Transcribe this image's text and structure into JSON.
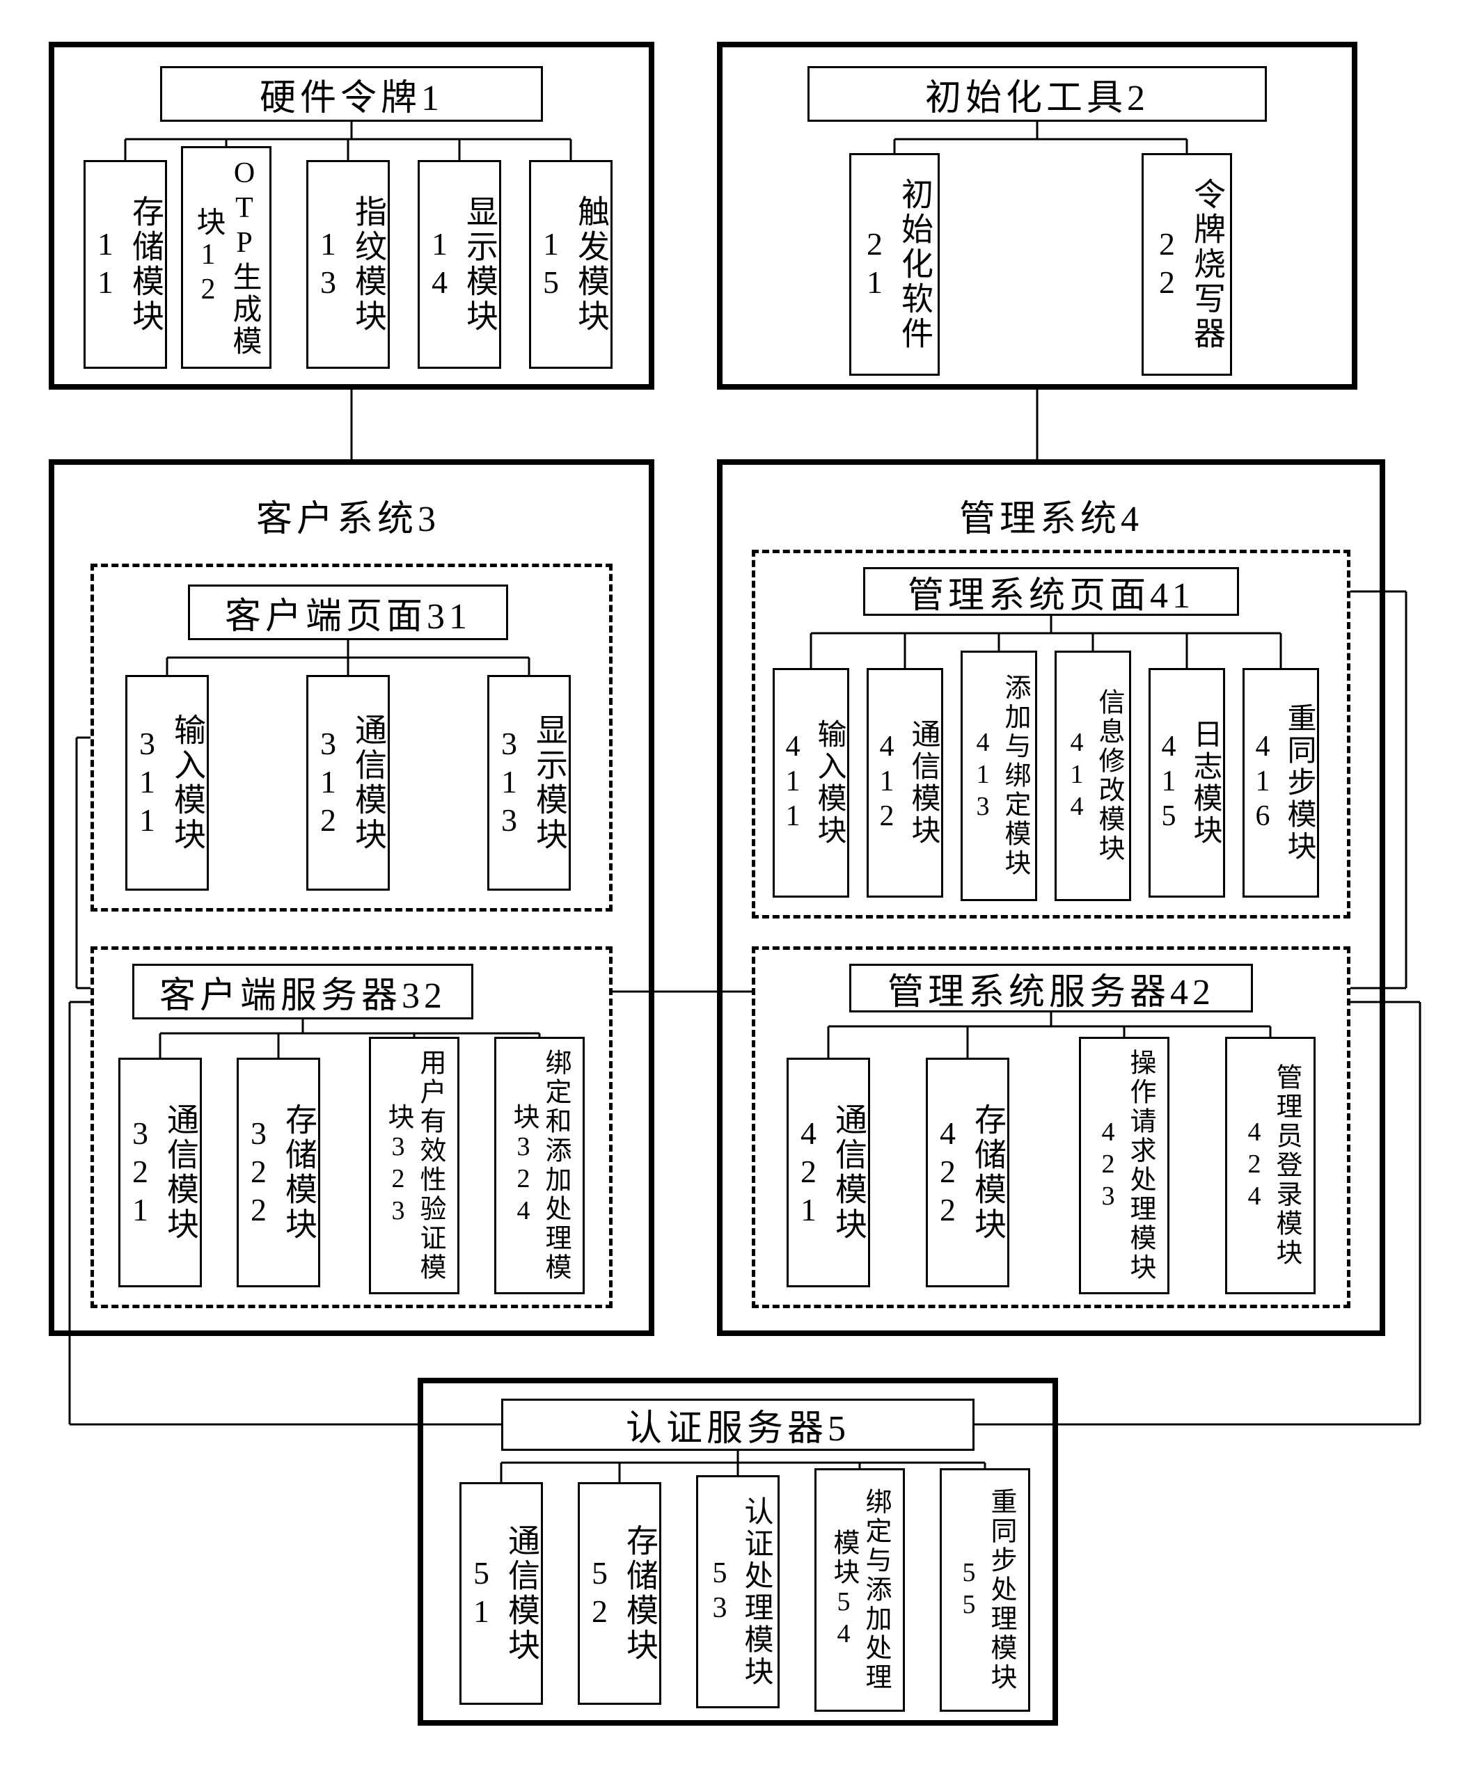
{
  "boxes": {
    "hw_token": {
      "title": "硬件令牌1",
      "mods": [
        "存储模块11",
        "OTP生成模块12",
        "指纹模块13",
        "显示模块14",
        "触发模块15"
      ]
    },
    "init_tool": {
      "title": "初始化工具2",
      "mods": [
        "初始化软件21",
        "令牌烧写器22"
      ]
    },
    "client_sys": {
      "title": "客户系统3"
    },
    "client_page": {
      "title": "客户端页面31",
      "mods": [
        "输入模块311",
        "通信模块312",
        "显示模块313"
      ]
    },
    "client_server": {
      "title": "客户端服务器32",
      "mods": [
        "通信模块321",
        "存储模块322",
        "用户有效性验证模块323",
        "绑定和添加处理模块324"
      ]
    },
    "mgmt_sys": {
      "title": "管理系统4"
    },
    "mgmt_page": {
      "title": "管理系统页面41",
      "mods": [
        "输入模块411",
        "通信模块412",
        "添加与绑定模块413",
        "信息修改模块414",
        "日志模块415",
        "重同步模块416"
      ]
    },
    "mgmt_server": {
      "title": "管理系统服务器42",
      "mods": [
        "通信模块421",
        "存储模块422",
        "操作请求处理模块423",
        "管理员登录模块424"
      ]
    },
    "auth_server": {
      "title": "认证服务器5",
      "mods": [
        "通信模块51",
        "存储模块52",
        "认证处理模块53",
        "绑定与添加处理模块54",
        "重同步处理模块55"
      ]
    }
  }
}
